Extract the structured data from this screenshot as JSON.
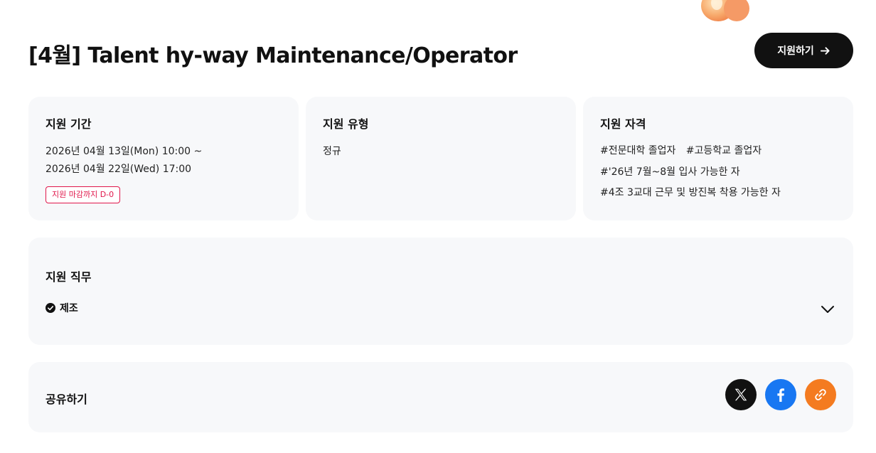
{
  "header": {
    "title": "[4월] Talent hy-way Maintenance/Operator",
    "apply_label": "지원하기"
  },
  "period": {
    "title": "지원 기간",
    "start": "2026년 04월 13일(Mon) 10:00 ~",
    "end": "2026년 04월 22일(Wed) 17:00",
    "deadline_badge": "지원 마감까지 D-0"
  },
  "type": {
    "title": "지원 유형",
    "value": "정규"
  },
  "qualification": {
    "title": "지원 자격",
    "tags_row1": [
      "#전문대학 졸업자",
      "#고등학교 졸업자"
    ],
    "tag_row2": "#'26년 7월~8월 입사 가능한 자",
    "tag_row3": "#4조 3교대 근무 및 방진복 착용 가능한 자"
  },
  "job": {
    "title": "지원 직무",
    "item": "제조"
  },
  "share": {
    "title": "공유하기"
  },
  "colors": {
    "accent_dark": "#111111",
    "card_bg": "#f7f8fa",
    "deadline_red": "#e0164a",
    "facebook_blue": "#1877f2",
    "link_orange": "#f47b20"
  },
  "icons": [
    "arrow-right-icon",
    "check-circle-icon",
    "chevron-down-icon",
    "x-logo-icon",
    "facebook-logo-icon",
    "link-icon",
    "decorative-shape"
  ]
}
